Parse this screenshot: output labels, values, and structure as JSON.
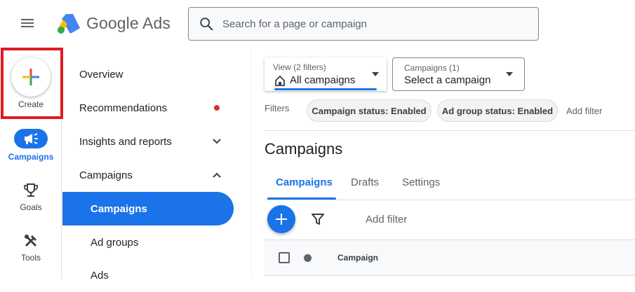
{
  "header": {
    "brand_google": "Google",
    "brand_ads": "Ads",
    "search_placeholder": "Search for a page or campaign"
  },
  "rail": {
    "create_label": "Create",
    "items": [
      {
        "label": "Campaigns",
        "icon": "megaphone-icon",
        "active": true
      },
      {
        "label": "Goals",
        "icon": "trophy-icon",
        "active": false
      },
      {
        "label": "Tools",
        "icon": "tools-icon",
        "active": false
      }
    ]
  },
  "nav": {
    "items": [
      {
        "label": "Overview"
      },
      {
        "label": "Recommendations",
        "badge": "red-dot"
      },
      {
        "label": "Insights and reports",
        "chevron": "down"
      },
      {
        "label": "Campaigns",
        "chevron": "up"
      },
      {
        "label": "Campaigns",
        "sub": true,
        "active": true
      },
      {
        "label": "Ad groups",
        "sub": true
      },
      {
        "label": "Ads",
        "sub": true
      }
    ]
  },
  "filters": {
    "view_top": "View (2 filters)",
    "view_value": "All campaigns",
    "campaign_top": "Campaigns (1)",
    "campaign_value": "Select a campaign",
    "label": "Filters",
    "chips": [
      "Campaign status: Enabled",
      "Ad group status: Enabled"
    ],
    "add_filter": "Add filter"
  },
  "main": {
    "title": "Campaigns",
    "tabs": [
      {
        "label": "Campaigns",
        "active": true
      },
      {
        "label": "Drafts"
      },
      {
        "label": "Settings"
      }
    ],
    "table": {
      "add_filter": "Add filter",
      "columns": [
        "Campaign"
      ]
    }
  },
  "colors": {
    "accent": "#1a73e8",
    "highlight_box": "#e21b22",
    "notification_dot": "#d93025"
  }
}
